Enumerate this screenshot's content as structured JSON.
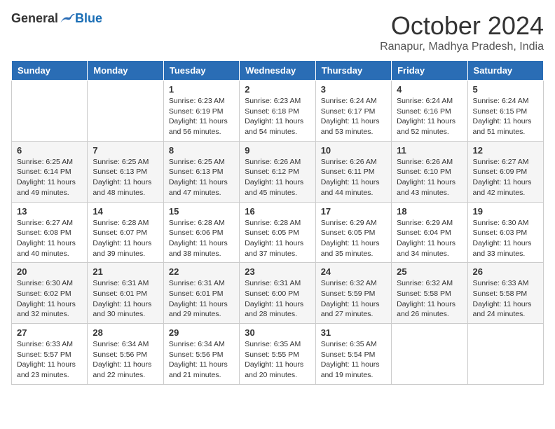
{
  "logo": {
    "general": "General",
    "blue": "Blue"
  },
  "title": "October 2024",
  "location": "Ranapur, Madhya Pradesh, India",
  "days_of_week": [
    "Sunday",
    "Monday",
    "Tuesday",
    "Wednesday",
    "Thursday",
    "Friday",
    "Saturday"
  ],
  "weeks": [
    [
      {
        "day": "",
        "info": ""
      },
      {
        "day": "",
        "info": ""
      },
      {
        "day": "1",
        "info": "Sunrise: 6:23 AM\nSunset: 6:19 PM\nDaylight: 11 hours and 56 minutes."
      },
      {
        "day": "2",
        "info": "Sunrise: 6:23 AM\nSunset: 6:18 PM\nDaylight: 11 hours and 54 minutes."
      },
      {
        "day": "3",
        "info": "Sunrise: 6:24 AM\nSunset: 6:17 PM\nDaylight: 11 hours and 53 minutes."
      },
      {
        "day": "4",
        "info": "Sunrise: 6:24 AM\nSunset: 6:16 PM\nDaylight: 11 hours and 52 minutes."
      },
      {
        "day": "5",
        "info": "Sunrise: 6:24 AM\nSunset: 6:15 PM\nDaylight: 11 hours and 51 minutes."
      }
    ],
    [
      {
        "day": "6",
        "info": "Sunrise: 6:25 AM\nSunset: 6:14 PM\nDaylight: 11 hours and 49 minutes."
      },
      {
        "day": "7",
        "info": "Sunrise: 6:25 AM\nSunset: 6:13 PM\nDaylight: 11 hours and 48 minutes."
      },
      {
        "day": "8",
        "info": "Sunrise: 6:25 AM\nSunset: 6:13 PM\nDaylight: 11 hours and 47 minutes."
      },
      {
        "day": "9",
        "info": "Sunrise: 6:26 AM\nSunset: 6:12 PM\nDaylight: 11 hours and 45 minutes."
      },
      {
        "day": "10",
        "info": "Sunrise: 6:26 AM\nSunset: 6:11 PM\nDaylight: 11 hours and 44 minutes."
      },
      {
        "day": "11",
        "info": "Sunrise: 6:26 AM\nSunset: 6:10 PM\nDaylight: 11 hours and 43 minutes."
      },
      {
        "day": "12",
        "info": "Sunrise: 6:27 AM\nSunset: 6:09 PM\nDaylight: 11 hours and 42 minutes."
      }
    ],
    [
      {
        "day": "13",
        "info": "Sunrise: 6:27 AM\nSunset: 6:08 PM\nDaylight: 11 hours and 40 minutes."
      },
      {
        "day": "14",
        "info": "Sunrise: 6:28 AM\nSunset: 6:07 PM\nDaylight: 11 hours and 39 minutes."
      },
      {
        "day": "15",
        "info": "Sunrise: 6:28 AM\nSunset: 6:06 PM\nDaylight: 11 hours and 38 minutes."
      },
      {
        "day": "16",
        "info": "Sunrise: 6:28 AM\nSunset: 6:05 PM\nDaylight: 11 hours and 37 minutes."
      },
      {
        "day": "17",
        "info": "Sunrise: 6:29 AM\nSunset: 6:05 PM\nDaylight: 11 hours and 35 minutes."
      },
      {
        "day": "18",
        "info": "Sunrise: 6:29 AM\nSunset: 6:04 PM\nDaylight: 11 hours and 34 minutes."
      },
      {
        "day": "19",
        "info": "Sunrise: 6:30 AM\nSunset: 6:03 PM\nDaylight: 11 hours and 33 minutes."
      }
    ],
    [
      {
        "day": "20",
        "info": "Sunrise: 6:30 AM\nSunset: 6:02 PM\nDaylight: 11 hours and 32 minutes."
      },
      {
        "day": "21",
        "info": "Sunrise: 6:31 AM\nSunset: 6:01 PM\nDaylight: 11 hours and 30 minutes."
      },
      {
        "day": "22",
        "info": "Sunrise: 6:31 AM\nSunset: 6:01 PM\nDaylight: 11 hours and 29 minutes."
      },
      {
        "day": "23",
        "info": "Sunrise: 6:31 AM\nSunset: 6:00 PM\nDaylight: 11 hours and 28 minutes."
      },
      {
        "day": "24",
        "info": "Sunrise: 6:32 AM\nSunset: 5:59 PM\nDaylight: 11 hours and 27 minutes."
      },
      {
        "day": "25",
        "info": "Sunrise: 6:32 AM\nSunset: 5:58 PM\nDaylight: 11 hours and 26 minutes."
      },
      {
        "day": "26",
        "info": "Sunrise: 6:33 AM\nSunset: 5:58 PM\nDaylight: 11 hours and 24 minutes."
      }
    ],
    [
      {
        "day": "27",
        "info": "Sunrise: 6:33 AM\nSunset: 5:57 PM\nDaylight: 11 hours and 23 minutes."
      },
      {
        "day": "28",
        "info": "Sunrise: 6:34 AM\nSunset: 5:56 PM\nDaylight: 11 hours and 22 minutes."
      },
      {
        "day": "29",
        "info": "Sunrise: 6:34 AM\nSunset: 5:56 PM\nDaylight: 11 hours and 21 minutes."
      },
      {
        "day": "30",
        "info": "Sunrise: 6:35 AM\nSunset: 5:55 PM\nDaylight: 11 hours and 20 minutes."
      },
      {
        "day": "31",
        "info": "Sunrise: 6:35 AM\nSunset: 5:54 PM\nDaylight: 11 hours and 19 minutes."
      },
      {
        "day": "",
        "info": ""
      },
      {
        "day": "",
        "info": ""
      }
    ]
  ]
}
